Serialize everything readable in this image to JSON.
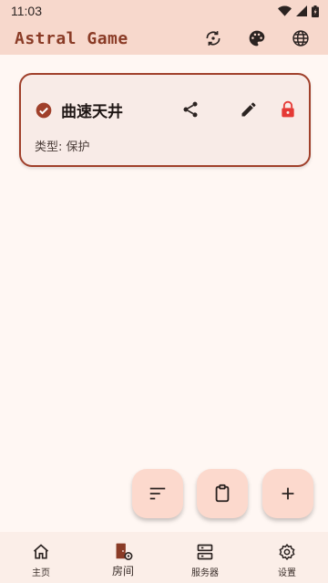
{
  "status_bar": {
    "time": "11:03"
  },
  "app_bar": {
    "title": "Astral Game"
  },
  "room_card": {
    "name": "曲速天井",
    "type_line": "类型: 保护"
  },
  "bottom_nav": {
    "items": [
      {
        "label": "主页",
        "icon": "home-icon"
      },
      {
        "label": "房间",
        "icon": "room-icon"
      },
      {
        "label": "服务器",
        "icon": "server-icon"
      },
      {
        "label": "设置",
        "icon": "settings-icon"
      }
    ],
    "active_index": 1
  },
  "colors": {
    "accent": "#a0402b",
    "lock": "#e53935",
    "app_bar_bg": "#f7d8cc",
    "fab_bg": "#fcd9cd"
  }
}
